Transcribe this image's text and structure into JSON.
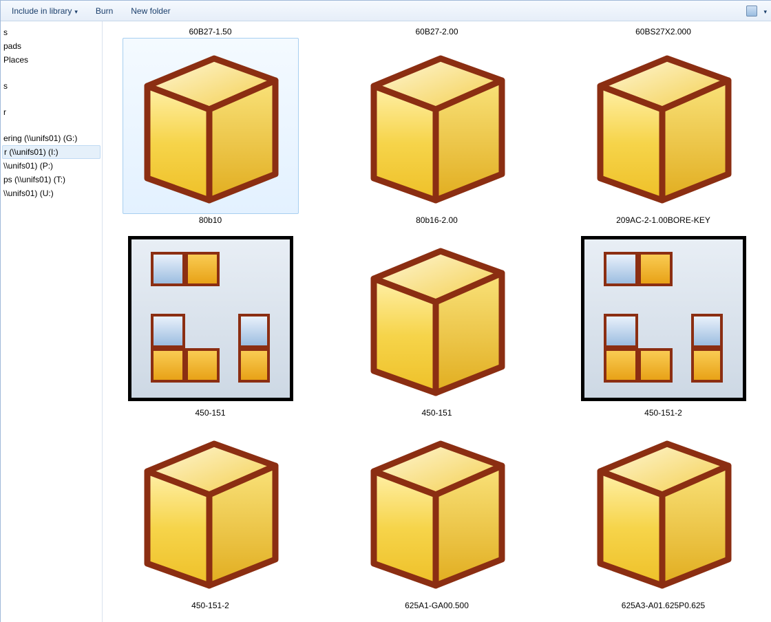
{
  "toolbar": {
    "include_label": "Include in library",
    "burn_label": "Burn",
    "new_folder_label": "New folder"
  },
  "sidebar": {
    "items": [
      {
        "label": "s",
        "spacer_before": false
      },
      {
        "label": "pads",
        "spacer_before": false
      },
      {
        "label": "Places",
        "spacer_before": false
      },
      {
        "label": "s",
        "spacer_before": true
      },
      {
        "label": "r",
        "spacer_before": true
      },
      {
        "label": "ering (\\\\unifs01) (G:)",
        "spacer_before": true
      },
      {
        "label": "r (\\\\unifs01) (I:)",
        "spacer_before": false,
        "selected": true
      },
      {
        "label": "\\\\unifs01) (P:)",
        "spacer_before": false
      },
      {
        "label": "ps (\\\\unifs01) (T:)",
        "spacer_before": false
      },
      {
        "label": "\\\\unifs01) (U:)",
        "spacer_before": false
      }
    ]
  },
  "files": [
    {
      "top": "60B27-1.50",
      "bottom": "80b10",
      "type": "part",
      "selected": true
    },
    {
      "top": "60B27-2.00",
      "bottom": "80b16-2.00",
      "type": "part"
    },
    {
      "top": "60BS27X2.000",
      "bottom": "209AC-2-1.00BORE-KEY",
      "type": "part"
    },
    {
      "top": "",
      "bottom": "450-151",
      "type": "assembly"
    },
    {
      "top": "",
      "bottom": "450-151",
      "type": "part"
    },
    {
      "top": "",
      "bottom": "450-151-2",
      "type": "assembly"
    },
    {
      "top": "",
      "bottom": "450-151-2",
      "type": "part"
    },
    {
      "top": "",
      "bottom": "625A1-GA00.500",
      "type": "part"
    },
    {
      "top": "",
      "bottom": "625A3-A01.625P0.625",
      "type": "part"
    }
  ]
}
